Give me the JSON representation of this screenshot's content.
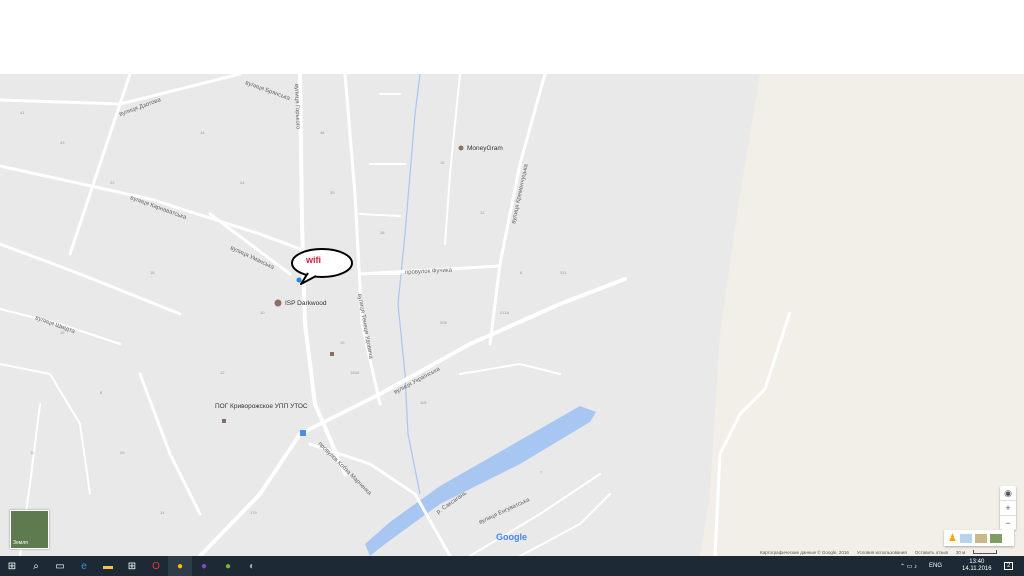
{
  "map": {
    "streets": [
      "вулиця Горького",
      "вулиця Дзотова",
      "вулиця Карнаватська",
      "вулиця Брянська",
      "вулиця Уманська",
      "провулок Фучика",
      "вулиця Тенеця Удовича",
      "вулиця Українська",
      "провулок Кобза Марченка",
      "вулиця Енгуватська",
      "вулиця Шмідта",
      "вулиця Кременчуцька"
    ],
    "river": "р. Саксагань",
    "pois": [
      {
        "label": "MoneyGram"
      },
      {
        "label": "ISP Darkwood"
      },
      {
        "label": "ПОГ Криворожское УПП УТОС"
      }
    ],
    "annotation": "wifi"
  },
  "controls": {
    "map_type_label": "Земля",
    "zoom_in": "+",
    "zoom_out": "−",
    "logo": "Google"
  },
  "footer": {
    "copyright": "Картографические данные © Google, 2016",
    "terms": "Условия использования",
    "feedback": "Оставить отзыв",
    "scale": "30 м"
  },
  "taskbar": {
    "lang": "ENG",
    "time": "13:40",
    "date": "14.11.2016",
    "notif_count": "2"
  },
  "colors": {
    "land": "#e9e9e9",
    "road": "#ffffff",
    "water": "#a7c7f2",
    "open_area": "#f1efe7",
    "callout_text": "#d81b3b"
  }
}
